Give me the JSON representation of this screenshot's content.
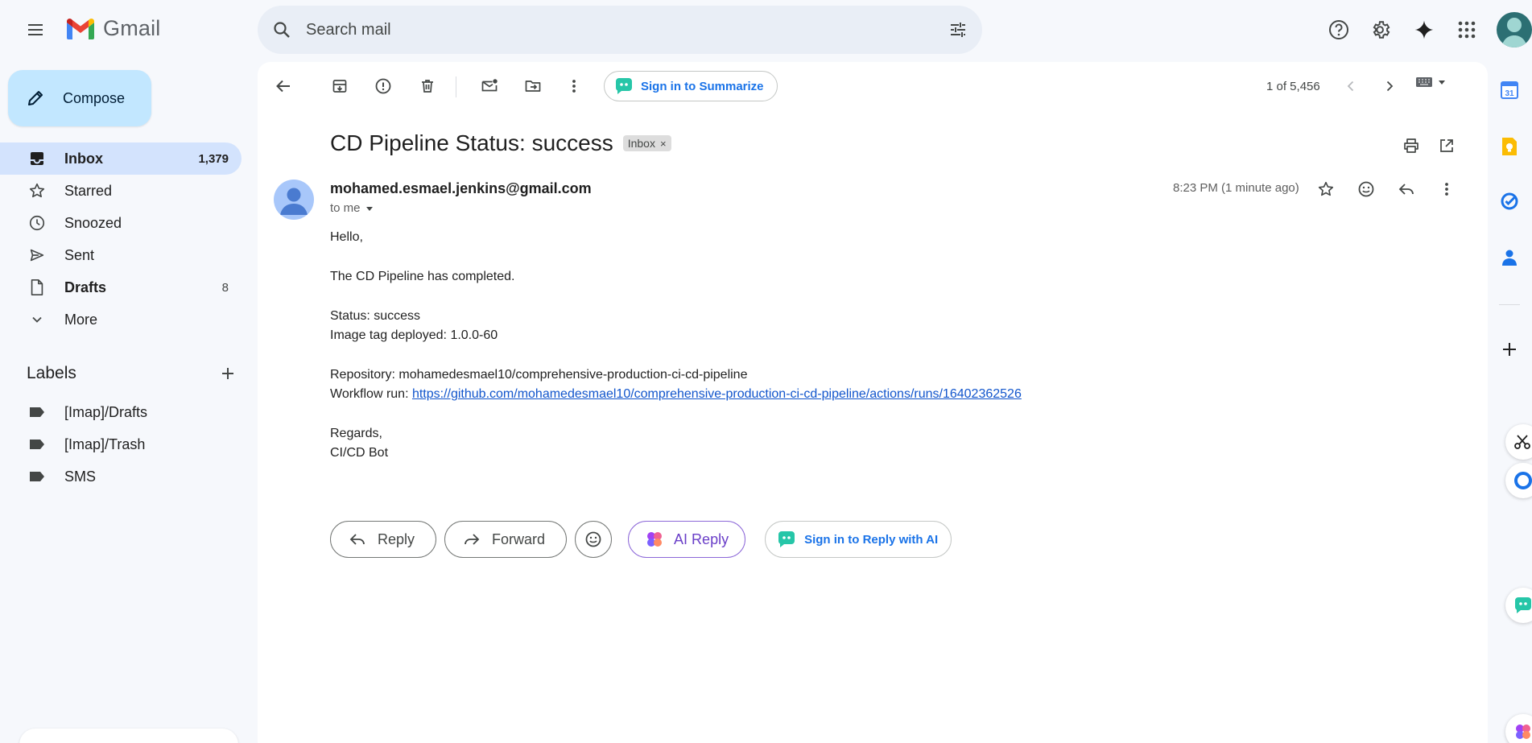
{
  "app": {
    "name": "Gmail"
  },
  "search": {
    "placeholder": "Search mail"
  },
  "compose": {
    "label": "Compose"
  },
  "nav": {
    "items": [
      {
        "label": "Inbox",
        "count": "1,379"
      },
      {
        "label": "Starred",
        "count": ""
      },
      {
        "label": "Snoozed",
        "count": ""
      },
      {
        "label": "Sent",
        "count": ""
      },
      {
        "label": "Drafts",
        "count": "8"
      },
      {
        "label": "More",
        "count": ""
      }
    ]
  },
  "labels": {
    "title": "Labels",
    "items": [
      {
        "label": "[Imap]/Drafts"
      },
      {
        "label": "[Imap]/Trash"
      },
      {
        "label": "SMS"
      }
    ]
  },
  "toolbar": {
    "summarize_label": "Sign in to Summarize",
    "pager": "1 of 5,456"
  },
  "message": {
    "subject": "CD Pipeline Status: success",
    "label_chip": "Inbox",
    "label_chip_close": "×",
    "sender": "mohamed.esmael.jenkins@gmail.com",
    "recipient": "to me",
    "time": "8:23 PM (1 minute ago)",
    "body": {
      "greeting": "Hello,",
      "line1": "The CD Pipeline has completed.",
      "status": "Status: success",
      "image_tag": "Image tag deployed: 1.0.0-60",
      "repository": "Repository: mohamedesmael10/comprehensive-production-ci-cd-pipeline",
      "workflow_prefix": "Workflow run: ",
      "workflow_url": "https://github.com/mohamedesmael10/comprehensive-production-ci-cd-pipeline/actions/runs/16402362526",
      "regards": "Regards,",
      "signature": "CI/CD Bot"
    }
  },
  "actions": {
    "reply": "Reply",
    "forward": "Forward",
    "ai_reply": "AI Reply",
    "sign_in_reply_ai": "Sign in to Reply with AI"
  },
  "side_panel": {
    "calendar_day": "31"
  },
  "colors": {
    "background": "#f6f8fc",
    "compose_bg": "#c2e7ff",
    "active_nav_bg": "#d3e3fd",
    "link": "#1155cc",
    "accent_blue": "#1a73e8",
    "ai_purple": "#6a3fc8"
  }
}
